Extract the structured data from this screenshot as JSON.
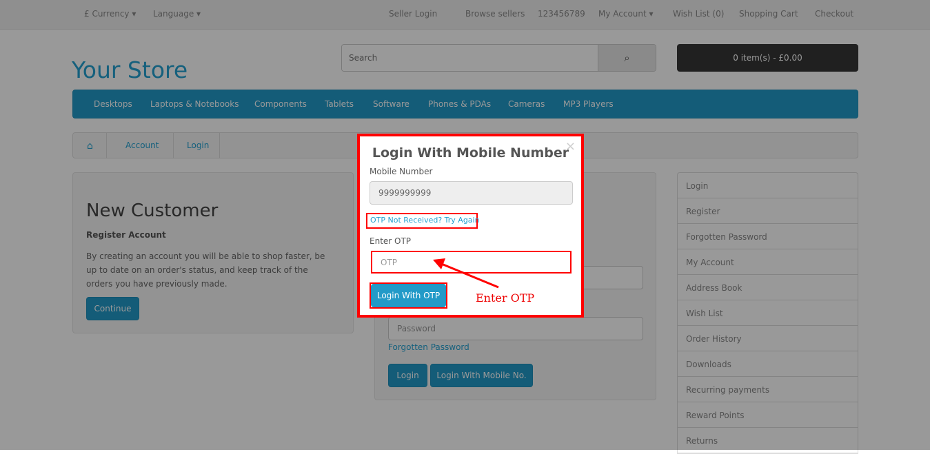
{
  "topbar": {
    "currency": "£ Currency ▾",
    "language": "Language ▾",
    "seller_login": "Seller Login",
    "browse_sellers": "Browse sellers",
    "phone": "123456789",
    "my_account": "My Account ▾",
    "wish_list": "Wish List (0)",
    "shopping_cart": "Shopping Cart",
    "checkout": "Checkout"
  },
  "header": {
    "logo": "Your Store",
    "search_placeholder": "Search",
    "cart": "0 item(s) - £0.00"
  },
  "menu": [
    "Desktops",
    "Laptops & Notebooks",
    "Components",
    "Tablets",
    "Software",
    "Phones & PDAs",
    "Cameras",
    "MP3 Players"
  ],
  "breadcrumb": [
    "Account",
    "Login"
  ],
  "new_customer": {
    "title": "New Customer",
    "subtitle": "Register Account",
    "text": "By creating an account you will be able to shop faster, be up to date on an order's status, and keep track of the orders you have previously made.",
    "button": "Continue"
  },
  "returning": {
    "password_placeholder": "Password",
    "forgotten": "Forgotten Password",
    "login": "Login",
    "login_mobile": "Login With Mobile No."
  },
  "sidebar": [
    "Login",
    "Register",
    "Forgotten Password",
    "My Account",
    "Address Book",
    "Wish List",
    "Order History",
    "Downloads",
    "Recurring payments",
    "Reward Points",
    "Returns"
  ],
  "modal": {
    "title": "Login With Mobile Number",
    "close": "×",
    "mobile_label": "Mobile Number",
    "mobile_value": "9999999999",
    "retry": "OTP Not Received? Try Again",
    "otp_label": "Enter OTP",
    "otp_placeholder": "OTP",
    "submit": "Login With OTP",
    "annotation": "Enter OTP"
  }
}
